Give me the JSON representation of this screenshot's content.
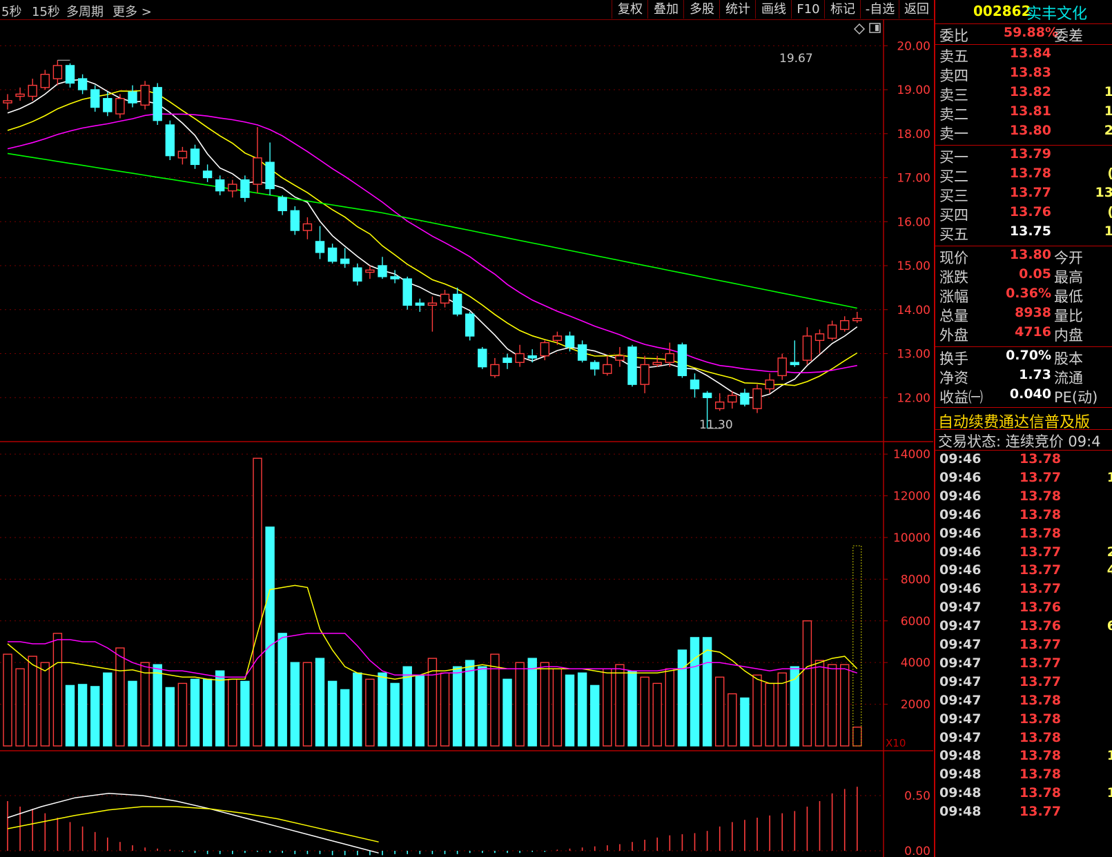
{
  "toolbar": {
    "left_items": [
      "5秒",
      "15秒",
      "多周期",
      "更多 >"
    ],
    "buttons": [
      "复权",
      "叠加",
      "多股",
      "统计",
      "画线",
      "F10",
      "标记",
      "-自选",
      "返回"
    ]
  },
  "chart": {
    "price_axis": [
      "20.00",
      "19.00",
      "18.00",
      "17.00",
      "16.00",
      "15.00",
      "14.00",
      "13.00",
      "12.00"
    ],
    "price_range": [
      11.0,
      20.6
    ],
    "high_marker": "19.67",
    "low_marker": "11.30",
    "volume_axis": [
      "14000",
      "12000",
      "10000",
      "8000",
      "6000",
      "4000",
      "2000"
    ],
    "volume_range": [
      0,
      14000
    ],
    "volume_unit": "X10",
    "macd_axis": [
      "0.50",
      "0.00"
    ],
    "colors": {
      "up": "#ff3c3c",
      "down": "#40ffff",
      "ma5": "#ffffff",
      "ma10": "#ffff00",
      "ma20": "#ff00ff",
      "ma60": "#00ff00"
    },
    "candles": [
      {
        "o": 18.7,
        "c": 18.75,
        "h": 18.9,
        "l": 18.55,
        "v": 4400
      },
      {
        "o": 18.85,
        "c": 18.9,
        "h": 19.05,
        "l": 18.75,
        "v": 3700
      },
      {
        "o": 18.85,
        "c": 19.1,
        "h": 19.25,
        "l": 18.75,
        "v": 4300
      },
      {
        "o": 19.05,
        "c": 19.35,
        "h": 19.45,
        "l": 19.0,
        "v": 4000
      },
      {
        "o": 19.25,
        "c": 19.55,
        "h": 19.67,
        "l": 19.1,
        "v": 5400
      },
      {
        "o": 19.55,
        "c": 19.15,
        "h": 19.6,
        "l": 19.05,
        "v": 2900
      },
      {
        "o": 19.25,
        "c": 19.0,
        "h": 19.35,
        "l": 18.9,
        "v": 2950
      },
      {
        "o": 19.0,
        "c": 18.6,
        "h": 19.1,
        "l": 18.5,
        "v": 2850
      },
      {
        "o": 18.8,
        "c": 18.5,
        "h": 18.95,
        "l": 18.4,
        "v": 3500
      },
      {
        "o": 18.45,
        "c": 18.8,
        "h": 18.9,
        "l": 18.35,
        "v": 4700
      },
      {
        "o": 18.95,
        "c": 18.7,
        "h": 19.1,
        "l": 18.6,
        "v": 3100
      },
      {
        "o": 18.65,
        "c": 19.1,
        "h": 19.2,
        "l": 18.55,
        "v": 4000
      },
      {
        "o": 19.05,
        "c": 18.3,
        "h": 19.15,
        "l": 18.2,
        "v": 3900
      },
      {
        "o": 18.2,
        "c": 17.5,
        "h": 18.3,
        "l": 17.4,
        "v": 2800
      },
      {
        "o": 17.45,
        "c": 17.6,
        "h": 17.7,
        "l": 17.3,
        "v": 3000
      },
      {
        "o": 17.65,
        "c": 17.3,
        "h": 17.75,
        "l": 17.2,
        "v": 3200
      },
      {
        "o": 17.15,
        "c": 17.0,
        "h": 17.3,
        "l": 16.9,
        "v": 3200
      },
      {
        "o": 16.95,
        "c": 16.7,
        "h": 17.05,
        "l": 16.6,
        "v": 3600
      },
      {
        "o": 16.7,
        "c": 16.85,
        "h": 16.95,
        "l": 16.55,
        "v": 3200
      },
      {
        "o": 16.95,
        "c": 16.55,
        "h": 17.05,
        "l": 16.45,
        "v": 3100
      },
      {
        "o": 16.85,
        "c": 17.45,
        "h": 18.15,
        "l": 16.65,
        "v": 13800
      },
      {
        "o": 17.35,
        "c": 16.75,
        "h": 17.8,
        "l": 16.6,
        "v": 10500
      },
      {
        "o": 16.55,
        "c": 16.25,
        "h": 16.6,
        "l": 16.15,
        "v": 5400
      },
      {
        "o": 16.25,
        "c": 15.8,
        "h": 16.35,
        "l": 15.7,
        "v": 4000
      },
      {
        "o": 15.8,
        "c": 15.95,
        "h": 16.1,
        "l": 15.6,
        "v": 4000
      },
      {
        "o": 15.55,
        "c": 15.3,
        "h": 15.9,
        "l": 15.15,
        "v": 4200
      },
      {
        "o": 15.4,
        "c": 15.1,
        "h": 15.5,
        "l": 15.05,
        "v": 3100
      },
      {
        "o": 15.15,
        "c": 15.05,
        "h": 15.4,
        "l": 14.95,
        "v": 2700
      },
      {
        "o": 14.95,
        "c": 14.65,
        "h": 15.05,
        "l": 14.55,
        "v": 3500
      },
      {
        "o": 14.85,
        "c": 14.9,
        "h": 15.0,
        "l": 14.7,
        "v": 3200
      },
      {
        "o": 15.0,
        "c": 14.75,
        "h": 15.2,
        "l": 14.7,
        "v": 3500
      },
      {
        "o": 14.75,
        "c": 14.7,
        "h": 14.9,
        "l": 14.6,
        "v": 3000
      },
      {
        "o": 14.7,
        "c": 14.1,
        "h": 14.75,
        "l": 14.0,
        "v": 3800
      },
      {
        "o": 14.15,
        "c": 14.1,
        "h": 14.25,
        "l": 13.95,
        "v": 3400
      },
      {
        "o": 14.1,
        "c": 14.15,
        "h": 14.3,
        "l": 13.5,
        "v": 4200
      },
      {
        "o": 14.15,
        "c": 14.35,
        "h": 14.45,
        "l": 14.05,
        "v": 3500
      },
      {
        "o": 14.35,
        "c": 13.9,
        "h": 14.5,
        "l": 13.85,
        "v": 3800
      },
      {
        "o": 13.9,
        "c": 13.4,
        "h": 13.95,
        "l": 13.3,
        "v": 4100
      },
      {
        "o": 13.1,
        "c": 12.7,
        "h": 13.15,
        "l": 12.65,
        "v": 3800
      },
      {
        "o": 12.5,
        "c": 12.75,
        "h": 12.9,
        "l": 12.45,
        "v": 4400
      },
      {
        "o": 12.9,
        "c": 12.8,
        "h": 13.0,
        "l": 12.65,
        "v": 3200
      },
      {
        "o": 12.8,
        "c": 13.0,
        "h": 13.2,
        "l": 12.7,
        "v": 4000
      },
      {
        "o": 12.95,
        "c": 12.9,
        "h": 13.1,
        "l": 12.8,
        "v": 4200
      },
      {
        "o": 12.95,
        "c": 13.25,
        "h": 13.3,
        "l": 12.85,
        "v": 4000
      },
      {
        "o": 13.3,
        "c": 13.4,
        "h": 13.5,
        "l": 13.2,
        "v": 3700
      },
      {
        "o": 13.4,
        "c": 13.15,
        "h": 13.5,
        "l": 13.05,
        "v": 3400
      },
      {
        "o": 13.2,
        "c": 12.85,
        "h": 13.3,
        "l": 12.8,
        "v": 3500
      },
      {
        "o": 12.8,
        "c": 12.65,
        "h": 12.85,
        "l": 12.5,
        "v": 2900
      },
      {
        "o": 12.55,
        "c": 12.75,
        "h": 12.95,
        "l": 12.5,
        "v": 3700
      },
      {
        "o": 12.85,
        "c": 12.95,
        "h": 13.15,
        "l": 12.7,
        "v": 3900
      },
      {
        "o": 13.15,
        "c": 12.3,
        "h": 13.2,
        "l": 12.25,
        "v": 3600
      },
      {
        "o": 12.3,
        "c": 12.75,
        "h": 12.95,
        "l": 12.1,
        "v": 3300
      },
      {
        "o": 12.75,
        "c": 12.8,
        "h": 12.95,
        "l": 12.7,
        "v": 3000
      },
      {
        "o": 12.8,
        "c": 13.0,
        "h": 13.25,
        "l": 12.7,
        "v": 3700
      },
      {
        "o": 13.2,
        "c": 12.5,
        "h": 13.25,
        "l": 12.45,
        "v": 4600
      },
      {
        "o": 12.4,
        "c": 12.2,
        "h": 12.55,
        "l": 12.0,
        "v": 5200
      },
      {
        "o": 12.1,
        "c": 12.0,
        "h": 12.15,
        "l": 11.3,
        "v": 5200
      },
      {
        "o": 11.75,
        "c": 11.9,
        "h": 12.1,
        "l": 11.7,
        "v": 3300
      },
      {
        "o": 11.9,
        "c": 12.05,
        "h": 12.15,
        "l": 11.75,
        "v": 2500
      },
      {
        "o": 12.1,
        "c": 11.85,
        "h": 12.2,
        "l": 11.8,
        "v": 2300
      },
      {
        "o": 11.75,
        "c": 12.2,
        "h": 12.3,
        "l": 11.65,
        "v": 3400
      },
      {
        "o": 12.2,
        "c": 12.4,
        "h": 12.55,
        "l": 12.1,
        "v": 3000
      },
      {
        "o": 12.5,
        "c": 12.9,
        "h": 13.0,
        "l": 12.4,
        "v": 3500
      },
      {
        "o": 12.8,
        "c": 12.75,
        "h": 13.3,
        "l": 12.7,
        "v": 3800
      },
      {
        "o": 12.85,
        "c": 13.4,
        "h": 13.6,
        "l": 12.75,
        "v": 6000
      },
      {
        "o": 13.3,
        "c": 13.45,
        "h": 13.55,
        "l": 13.0,
        "v": 4100
      },
      {
        "o": 13.35,
        "c": 13.65,
        "h": 13.75,
        "l": 13.3,
        "v": 3900
      },
      {
        "o": 13.55,
        "c": 13.75,
        "h": 13.85,
        "l": 13.5,
        "v": 3900
      },
      {
        "o": 13.75,
        "c": 13.8,
        "h": 13.95,
        "l": 13.7,
        "v": 900
      }
    ],
    "vol_ma5": [
      4900,
      4400,
      3900,
      3600,
      4000,
      4000,
      3900,
      3800,
      3700,
      3600,
      3650,
      3500,
      3500,
      3400,
      3300,
      3300,
      3200,
      3150,
      3200,
      3200,
      5400,
      7500,
      7600,
      7700,
      7600,
      5600,
      4600,
      3800,
      3500,
      3400,
      3300,
      3200,
      3300,
      3400,
      3600,
      3600,
      3700,
      3800,
      3900,
      3800,
      3700,
      3700,
      3700,
      3700,
      3700,
      3700,
      3700,
      3600,
      3500,
      3500,
      3500,
      3500,
      3500,
      3600,
      3700,
      4200,
      4600,
      4500,
      4100,
      3600,
      3200,
      3000,
      3000,
      3200,
      3800,
      4000,
      4200,
      4300,
      3700
    ],
    "vol_ma10": [
      5000,
      5000,
      4900,
      4900,
      5100,
      5100,
      5000,
      5000,
      4700,
      4300,
      4000,
      3800,
      3700,
      3600,
      3600,
      3500,
      3400,
      3300,
      3300,
      3300,
      4200,
      4800,
      5200,
      5300,
      5400,
      5400,
      5400,
      5400,
      4800,
      4100,
      3600,
      3400,
      3400,
      3400,
      3400,
      3500,
      3500,
      3600,
      3700,
      3700,
      3700,
      3700,
      3700,
      3800,
      3800,
      3700,
      3700,
      3700,
      3700,
      3700,
      3600,
      3600,
      3600,
      3700,
      3700,
      3800,
      4000,
      4000,
      3900,
      3800,
      3700,
      3600,
      3700,
      3700,
      3700,
      3800,
      3700,
      3700,
      3500
    ],
    "macd_bars": [
      0.45,
      0.4,
      0.38,
      0.34,
      0.3,
      0.26,
      0.22,
      0.17,
      0.12,
      0.08,
      0.05,
      0.03,
      0.02,
      0.01,
      -0.01,
      -0.02,
      -0.03,
      -0.03,
      -0.03,
      -0.02,
      -0.01,
      -0.02,
      -0.02,
      -0.03,
      -0.03,
      -0.03,
      -0.04,
      -0.04,
      -0.04,
      -0.04,
      -0.04,
      -0.03,
      -0.03,
      -0.03,
      -0.03,
      -0.03,
      -0.03,
      -0.02,
      -0.02,
      -0.02,
      -0.02,
      -0.02,
      -0.01,
      -0.01,
      0.01,
      0.02,
      0.03,
      0.04,
      0.05,
      0.06,
      0.08,
      0.1,
      0.12,
      0.14,
      0.15,
      0.16,
      0.18,
      0.22,
      0.26,
      0.28,
      0.3,
      0.32,
      0.34,
      0.36,
      0.4,
      0.45,
      0.52,
      0.56,
      0.58
    ],
    "macd_dif": [
      0.3,
      0.4,
      0.48,
      0.52,
      0.5,
      0.45,
      0.38,
      0.3,
      0.22,
      0.14,
      0.06,
      -0.02
    ],
    "macd_dea": [
      0.2,
      0.26,
      0.32,
      0.37,
      0.4,
      0.4,
      0.38,
      0.34,
      0.29,
      0.22,
      0.15,
      0.08
    ]
  },
  "panel": {
    "code": "002862",
    "name": "实丰文化",
    "ratio": {
      "label": "委比",
      "value": "59.88%",
      "label2": "委差"
    },
    "sell": [
      {
        "label": "卖五",
        "price": "13.84",
        "edge": ""
      },
      {
        "label": "卖四",
        "price": "13.83",
        "edge": ""
      },
      {
        "label": "卖三",
        "price": "13.82",
        "edge": "1"
      },
      {
        "label": "卖二",
        "price": "13.81",
        "edge": "1"
      },
      {
        "label": "卖一",
        "price": "13.80",
        "edge": "2"
      }
    ],
    "buy": [
      {
        "label": "买一",
        "price": "13.79",
        "edge": ""
      },
      {
        "label": "买二",
        "price": "13.78",
        "edge": "("
      },
      {
        "label": "买三",
        "price": "13.77",
        "edge": "13"
      },
      {
        "label": "买四",
        "price": "13.76",
        "edge": "("
      },
      {
        "label": "买五",
        "price": "13.75",
        "edge": "1"
      }
    ],
    "quote": [
      {
        "label": "现价",
        "value": "13.80",
        "label2": "今开"
      },
      {
        "label": "涨跌",
        "value": "0.05",
        "label2": "最高"
      },
      {
        "label": "涨幅",
        "value": "0.36%",
        "label2": "最低"
      },
      {
        "label": "总量",
        "value": "8938",
        "label2": "量比"
      },
      {
        "label": "外盘",
        "value": "4716",
        "label2": "内盘"
      }
    ],
    "fund": [
      {
        "label": "换手",
        "value": "0.70%",
        "label2": "股本"
      },
      {
        "label": "净资",
        "value": "1.73",
        "label2": "流通"
      },
      {
        "label": "收益㈠",
        "value": "0.040",
        "label2": "PE(动)"
      }
    ],
    "notice": "自动续费通达信普及版",
    "status": "交易状态: 连续竞价 09:4",
    "ticks": [
      {
        "t": "09:46",
        "p": "13.78",
        "v": ""
      },
      {
        "t": "09:46",
        "p": "13.77",
        "v": "1"
      },
      {
        "t": "09:46",
        "p": "13.78",
        "v": ""
      },
      {
        "t": "09:46",
        "p": "13.78",
        "v": ""
      },
      {
        "t": "09:46",
        "p": "13.78",
        "v": ""
      },
      {
        "t": "09:46",
        "p": "13.77",
        "v": "2"
      },
      {
        "t": "09:46",
        "p": "13.77",
        "v": "4"
      },
      {
        "t": "09:46",
        "p": "13.77",
        "v": ""
      },
      {
        "t": "09:47",
        "p": "13.76",
        "v": ""
      },
      {
        "t": "09:47",
        "p": "13.76",
        "v": "6"
      },
      {
        "t": "09:47",
        "p": "13.77",
        "v": ""
      },
      {
        "t": "09:47",
        "p": "13.77",
        "v": ""
      },
      {
        "t": "09:47",
        "p": "13.77",
        "v": ""
      },
      {
        "t": "09:47",
        "p": "13.78",
        "v": ""
      },
      {
        "t": "09:47",
        "p": "13.78",
        "v": ""
      },
      {
        "t": "09:47",
        "p": "13.78",
        "v": ""
      },
      {
        "t": "09:48",
        "p": "13.78",
        "v": "1"
      },
      {
        "t": "09:48",
        "p": "13.78",
        "v": ""
      },
      {
        "t": "09:48",
        "p": "13.78",
        "v": "1"
      },
      {
        "t": "09:48",
        "p": "13.77",
        "v": ""
      }
    ]
  }
}
